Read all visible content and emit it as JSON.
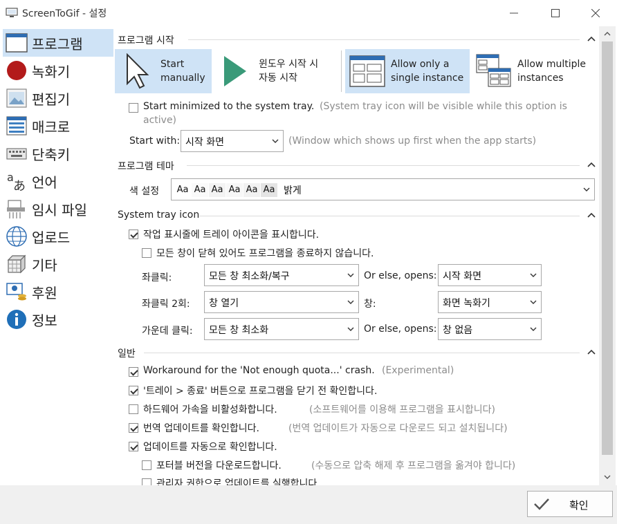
{
  "window": {
    "title": "ScreenToGif - 설정",
    "minimize_icon": "minimize-icon",
    "maximize_icon": "maximize-icon",
    "close_icon": "close-icon"
  },
  "sidebar": {
    "items": [
      {
        "label": "프로그램",
        "icon": "window-icon",
        "selected": true
      },
      {
        "label": "녹화기",
        "icon": "record-icon"
      },
      {
        "label": "편집기",
        "icon": "image-editor-icon"
      },
      {
        "label": "매크로",
        "icon": "macro-icon"
      },
      {
        "label": "단축키",
        "icon": "keyboard-icon"
      },
      {
        "label": "언어",
        "icon": "language-icon"
      },
      {
        "label": "임시 파일",
        "icon": "temp-files-icon"
      },
      {
        "label": "업로드",
        "icon": "globe-icon"
      },
      {
        "label": "기타",
        "icon": "extras-icon"
      },
      {
        "label": "후원",
        "icon": "donate-icon"
      },
      {
        "label": "정보",
        "icon": "info-icon"
      }
    ]
  },
  "startup": {
    "header": "프로그램 시작",
    "modes": [
      {
        "label": "Start\nmanually",
        "selected": true
      },
      {
        "label": "윈도우 시작 시\n자동 시작",
        "selected": false
      },
      {
        "label": "Allow only a\nsingle instance",
        "selected": true
      },
      {
        "label": "Allow multiple\ninstances",
        "selected": false
      }
    ],
    "minimized_label": "Start minimized to the system tray.",
    "minimized_hint_line1": "(System tray icon will be visible while this option is",
    "minimized_hint_line2": "active)",
    "start_with_label": "Start with:",
    "start_with_value": "시작 화면",
    "start_with_hint": "(Window which shows up first when the app starts)"
  },
  "theme": {
    "header": "프로그램 테마",
    "color_label": "색 설정",
    "swatches": [
      "Aa",
      "Aa",
      "Aa",
      "Aa",
      "Aa",
      "Aa"
    ],
    "value": "밝게"
  },
  "tray": {
    "header": "System tray icon",
    "show_icon_label": "작업 표시줄에 트레이 아이콘을 표시합니다.",
    "keep_running_label": "모든 창이 닫혀 있어도 프로그램을 종료하지 않습니다.",
    "rows": [
      {
        "label": "좌클릭:",
        "value": "모든 창 최소화/복구",
        "mid_label": "Or else, opens:",
        "right_value": "시작 화면"
      },
      {
        "label": "좌클릭 2회:",
        "value": "창 열기",
        "mid_label": "창:",
        "right_value": "화면 녹화기"
      },
      {
        "label": "가운데 클릭:",
        "value": "모든 창 최소화",
        "mid_label": "Or else, opens:",
        "right_value": "창 없음"
      }
    ]
  },
  "general": {
    "header": "일반",
    "options": [
      {
        "label": "Workaround for the 'Not enough quota...' crash.",
        "hint": "(Experimental)",
        "checked": true
      },
      {
        "label": "'트레이 > 종료' 버튼으로 프로그램을 닫기 전 확인합니다.",
        "hint": "",
        "checked": true
      },
      {
        "label": "하드웨어 가속을 비활성화합니다.",
        "hint": "(소프트웨어를 이용해 프로그램을 표시합니다)",
        "checked": false
      },
      {
        "label": "번역 업데이트를 확인합니다.",
        "hint": "(번역 업데이트가 자동으로 다운로드 되고 설치됩니다)",
        "checked": true
      },
      {
        "label": "업데이트를 자동으로 확인합니다.",
        "hint": "",
        "checked": true
      },
      {
        "label": "포터블 버전을 다운로드합니다.",
        "hint": "(수동으로 압축 해제 후 프로그램을 옮겨야 합니다)",
        "checked": false
      },
      {
        "label": "관리자 권한으로 업데이트를 실행합니다.",
        "hint": "",
        "checked": false
      }
    ]
  },
  "footer": {
    "ok_label": "확인"
  }
}
